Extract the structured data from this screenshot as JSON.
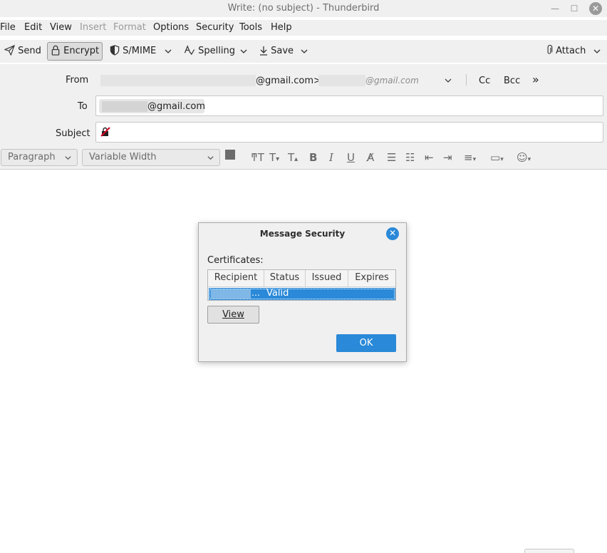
{
  "window": {
    "title": "Write: (no subject) - Thunderbird"
  },
  "menu": [
    {
      "label": "File",
      "disabled": false
    },
    {
      "label": "Edit",
      "disabled": false
    },
    {
      "label": "View",
      "disabled": false
    },
    {
      "label": "Insert",
      "disabled": true
    },
    {
      "label": "Format",
      "disabled": true
    },
    {
      "label": "Options",
      "disabled": false
    },
    {
      "label": "Security",
      "disabled": false
    },
    {
      "label": "Tools",
      "disabled": false
    },
    {
      "label": "Help",
      "disabled": false
    }
  ],
  "toolbar": {
    "send": "Send",
    "encrypt": "Encrypt",
    "smime": "S/MIME",
    "spelling": "Spelling",
    "save": "Save",
    "attach": "Attach"
  },
  "compose": {
    "from_label": "From",
    "from_value": "@gmail.com>",
    "from_identity_placeholder": "@gmail.com",
    "cc": "Cc",
    "bcc": "Bcc",
    "to_label": "To",
    "to_recipient": "@gmail.com",
    "subject_label": "Subject",
    "subject_value": ""
  },
  "format_bar": {
    "paragraph": "Paragraph",
    "font": "Variable Width"
  },
  "dialog": {
    "title": "Message Security",
    "certificates_label": "Certificates:",
    "columns": [
      "Recipient",
      "Status",
      "Issued",
      "Expires"
    ],
    "rows": [
      {
        "recipient": "…",
        "status": "Valid",
        "issued": "",
        "expires": ""
      }
    ],
    "view_button": "View",
    "ok_button": "OK"
  },
  "colors": {
    "accent": "#2a89d8",
    "chrome": "#f0f0f0"
  }
}
